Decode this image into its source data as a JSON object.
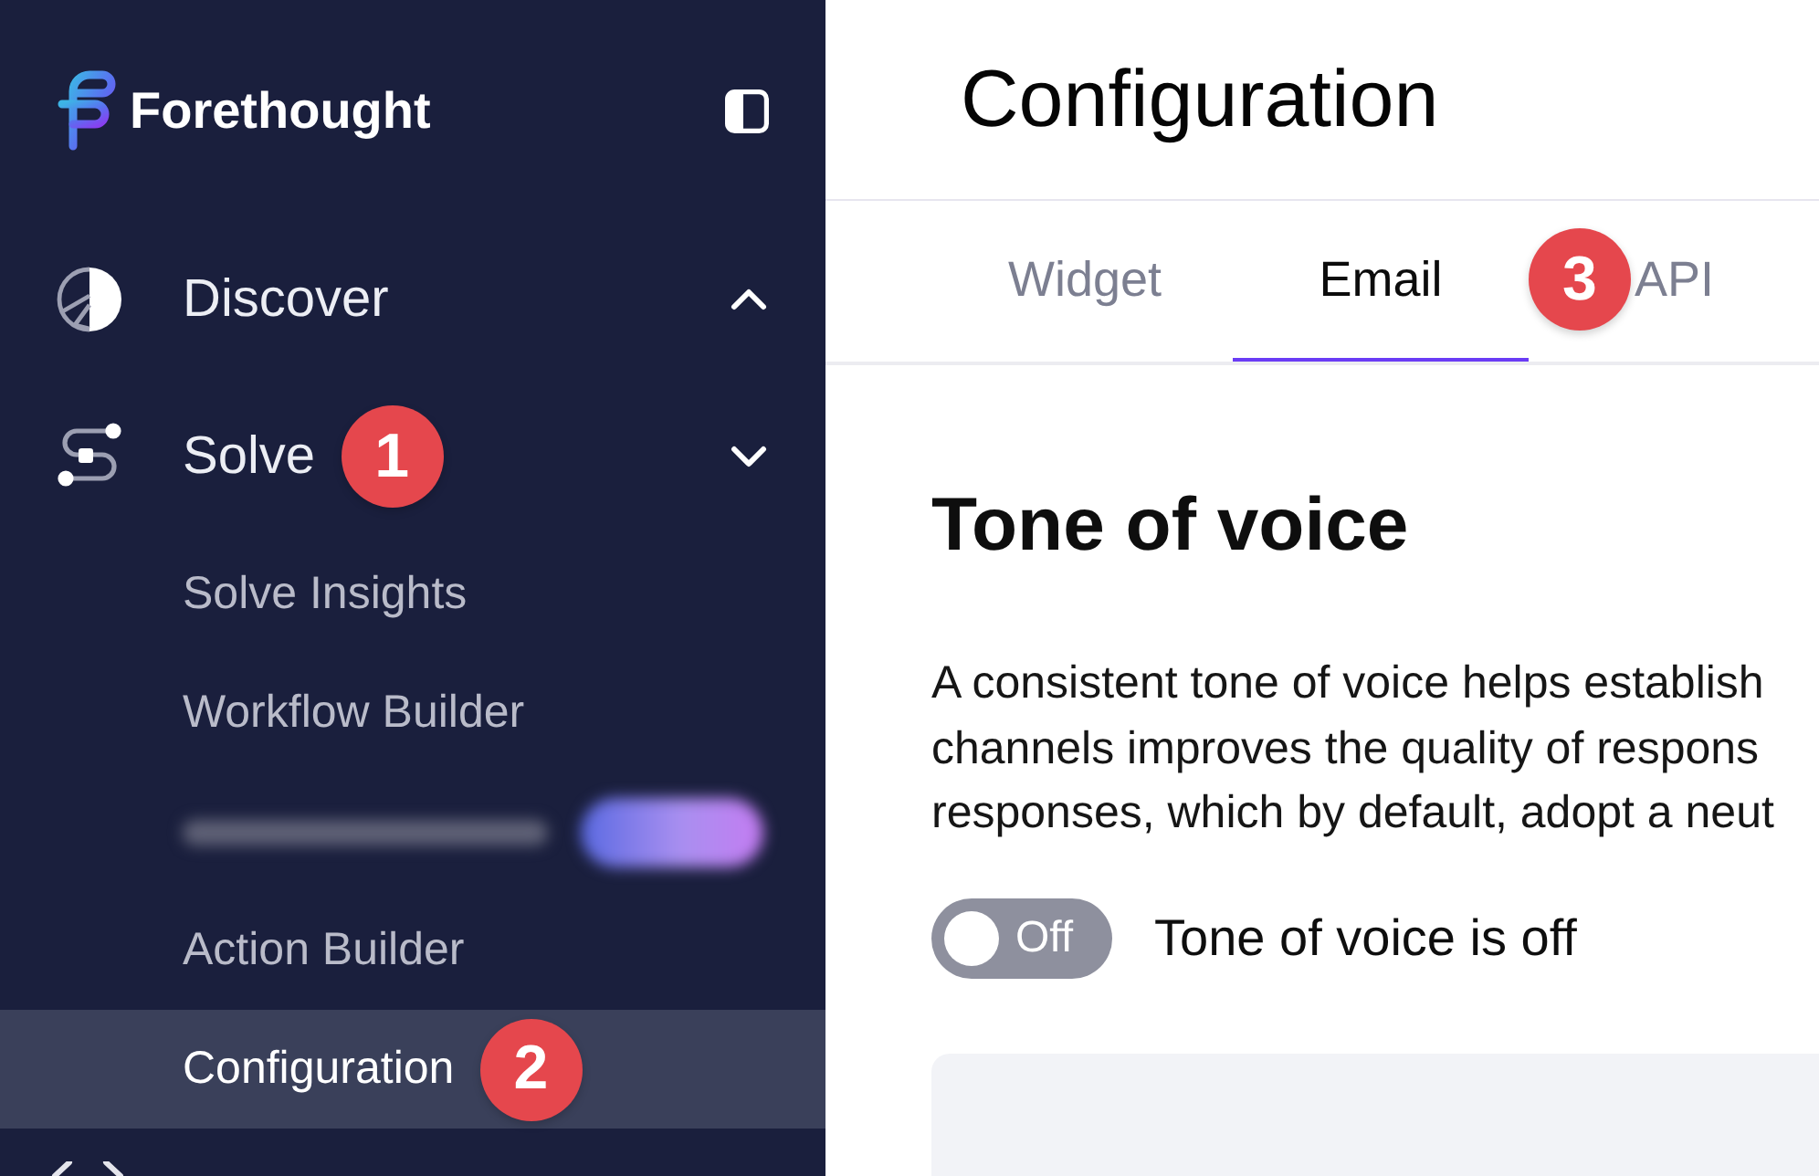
{
  "sidebar": {
    "brand": "Forethought",
    "nav": [
      {
        "kind": "analytics",
        "label": "Discover",
        "expanded": false
      },
      {
        "kind": "workflow",
        "label": "Solve",
        "expanded": true,
        "callout": "1",
        "children": [
          {
            "kind": "link",
            "label": "Solve Insights",
            "selected": false
          },
          {
            "kind": "link",
            "label": "Workflow Builder",
            "selected": false
          },
          {
            "kind": "redacted",
            "selected": false
          },
          {
            "kind": "link",
            "label": "Action Builder",
            "selected": false
          },
          {
            "kind": "link",
            "label": "Configuration",
            "selected": true,
            "callout": "2"
          }
        ]
      },
      {
        "kind": "code"
      }
    ]
  },
  "main": {
    "title": "Configuration",
    "tabs": [
      {
        "label": "Widget",
        "selected": false
      },
      {
        "label": "Email",
        "selected": true,
        "callout": "3"
      },
      {
        "label": "API",
        "selected": false
      }
    ],
    "section": {
      "heading": "Tone of voice",
      "description_lines": [
        "A consistent tone of voice helps establish",
        "channels improves the quality of respons",
        "responses, which by default, adopt a neut"
      ],
      "toggle": {
        "on": false,
        "text": "Off"
      },
      "toggle_label": "Tone of voice is off"
    }
  }
}
